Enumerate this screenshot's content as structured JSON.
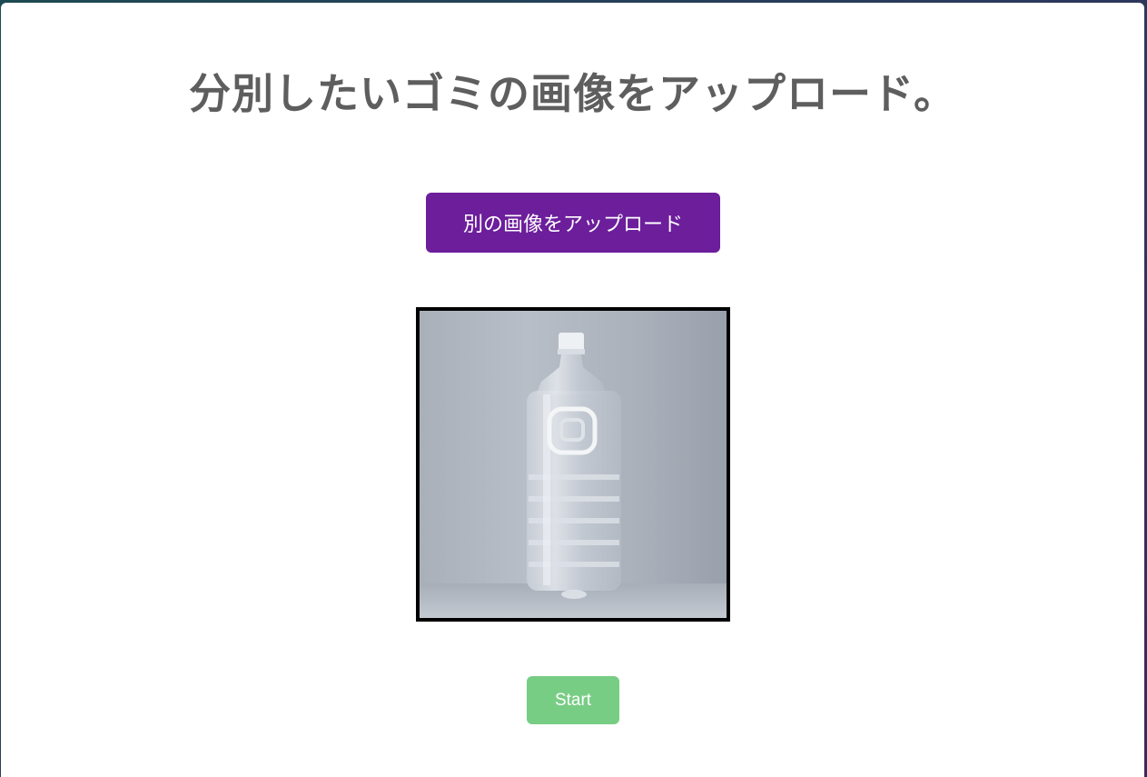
{
  "page": {
    "title": "分別したいゴミの画像をアップロード。"
  },
  "upload": {
    "button_label": "別の画像をアップロード"
  },
  "preview": {
    "image_subject": "plastic-bottle"
  },
  "actions": {
    "start_label": "Start"
  },
  "colors": {
    "title_text": "#5f5e5e",
    "upload_button": "#6c1e9b",
    "start_button": "#78cd85"
  }
}
